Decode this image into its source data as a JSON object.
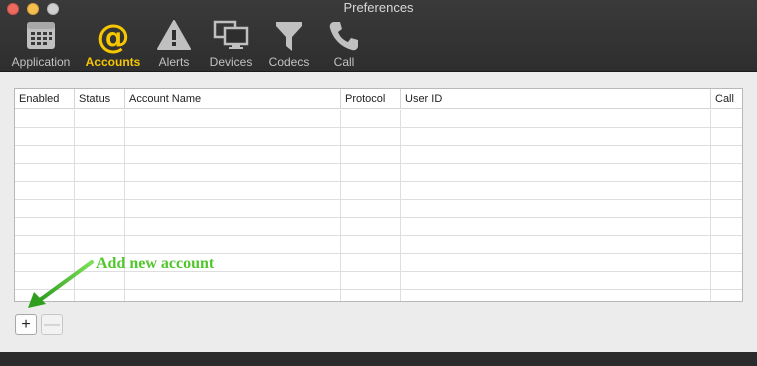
{
  "window": {
    "title": "Preferences"
  },
  "toolbar": {
    "items": [
      {
        "label": "Application",
        "icon": "calendar-grid-icon",
        "active": false
      },
      {
        "label": "Accounts",
        "icon": "at-sign-icon",
        "active": true
      },
      {
        "label": "Alerts",
        "icon": "warning-icon",
        "active": false
      },
      {
        "label": "Devices",
        "icon": "monitor-icon",
        "active": false
      },
      {
        "label": "Codecs",
        "icon": "filter-icon",
        "active": false
      },
      {
        "label": "Call",
        "icon": "phone-icon",
        "active": false
      }
    ]
  },
  "accounts_table": {
    "columns": [
      "Enabled",
      "Status",
      "Account Name",
      "Protocol",
      "User ID",
      "Call"
    ],
    "rows": []
  },
  "buttons": {
    "add_label": "+",
    "remove_label": "—"
  },
  "annotation": {
    "text": "Add new account",
    "color": "#52c62d"
  },
  "colors": {
    "accent": "#f6c700"
  }
}
